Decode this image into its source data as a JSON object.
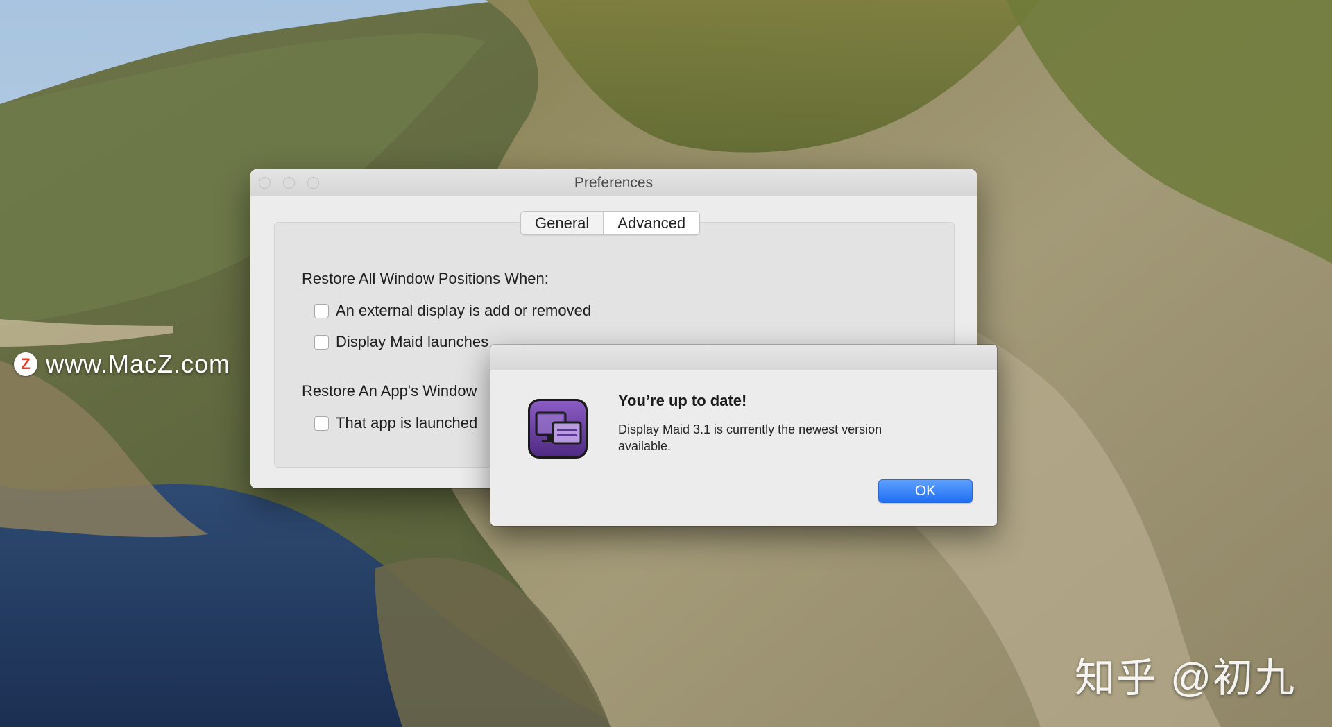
{
  "watermark": {
    "badge": "Z",
    "site": "www.MacZ.com",
    "zhihu": "知乎 @初九"
  },
  "preferences": {
    "title": "Preferences",
    "tabs": [
      {
        "label": "General",
        "selected": false
      },
      {
        "label": "Advanced",
        "selected": true
      }
    ],
    "restore_all_label": "Restore All Window Positions When:",
    "restore_all_options": [
      {
        "label": "An external display is add or removed",
        "checked": false
      },
      {
        "label": "Display Maid launches",
        "checked": false
      }
    ],
    "restore_app_label": "Restore An App's Window",
    "restore_app_options": [
      {
        "label": "That app is launched",
        "checked": false
      }
    ]
  },
  "alert": {
    "heading": "You’re up to date!",
    "message": "Display Maid 3.1 is currently the newest version available.",
    "ok_label": "OK",
    "icon": "display-maid-app-icon"
  },
  "colors": {
    "accent": "#1f6ff2",
    "icon_purple": "#6c3fa0"
  }
}
